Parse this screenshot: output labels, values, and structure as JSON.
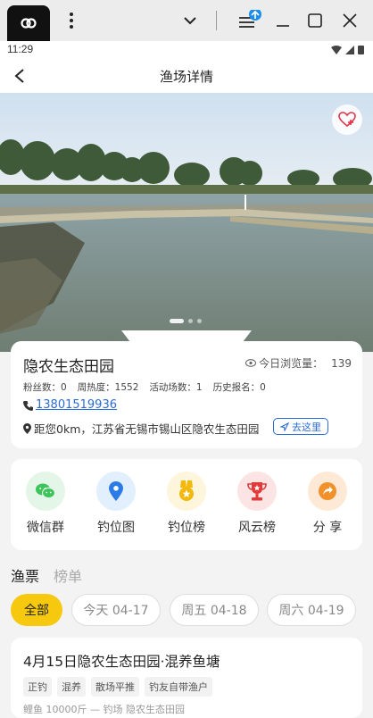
{
  "status": {
    "time": "11:29"
  },
  "header": {
    "title": "渔场详情"
  },
  "venue": {
    "name": "隐农生态田园",
    "views_label": "今日浏览量：",
    "views": "139",
    "stats": [
      "粉丝数：0",
      "周热度：1552",
      "活动场数：1",
      "历史报名：0"
    ],
    "phone": "13801519936",
    "address": "距您0km，江苏省无锡市锡山区隐农生态田园",
    "goto_label": "去这里"
  },
  "features": [
    {
      "label": "微信群",
      "icon": "wechat-icon",
      "color": "#3cc35a",
      "bg": "#e3f6e7"
    },
    {
      "label": "钓位图",
      "icon": "location-pin-icon",
      "color": "#2a7be6",
      "bg": "#e2effc"
    },
    {
      "label": "钓位榜",
      "icon": "medal-icon",
      "color": "#f2b90c",
      "bg": "#fdf6dc"
    },
    {
      "label": "风云榜",
      "icon": "trophy-icon",
      "color": "#e23a3a",
      "bg": "#fde4e4"
    },
    {
      "label": "分 享",
      "icon": "share-icon",
      "color": "#f2902a",
      "bg": "#fde9d6"
    }
  ],
  "tabs": [
    {
      "label": "渔票",
      "active": true
    },
    {
      "label": "榜单",
      "active": false
    }
  ],
  "date_chips": [
    "全部",
    "今天 04-17",
    "周五 04-18",
    "周六 04-19"
  ],
  "ticket": {
    "title": "4月15日隐农生态田园·混养鱼塘",
    "tags": [
      "正钓",
      "混养",
      "散场平推",
      "钓友自带渔户"
    ],
    "sub": "鲤鱼  10000斤  —  钓场  隐农生态田园"
  },
  "colors": {
    "accent": "#f6c90e",
    "link": "#2a6bd6"
  }
}
